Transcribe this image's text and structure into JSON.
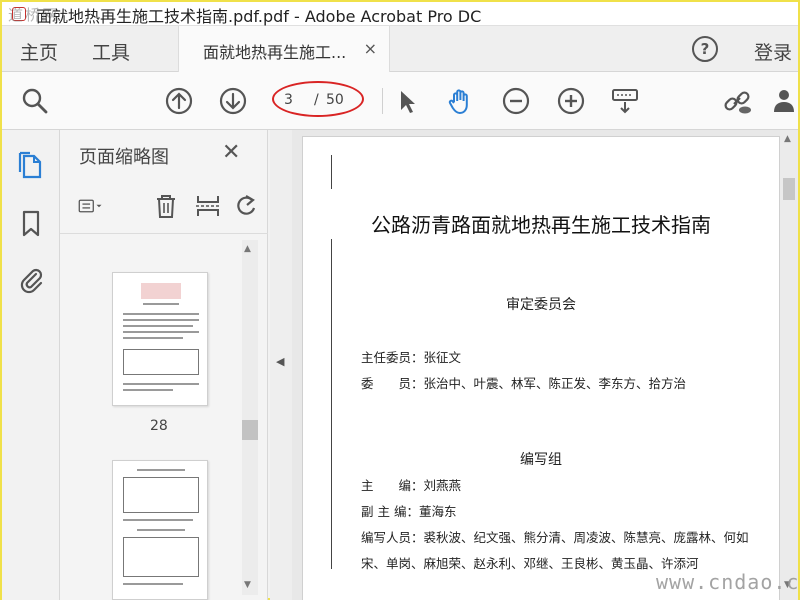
{
  "window": {
    "title": "面就地热再生施工技术指南.pdf.pdf - Adobe Acrobat Pro DC",
    "watermark_top": "道桥网"
  },
  "tabs": {
    "home": "主页",
    "tools": "工具",
    "document": "面就地热再生施工...",
    "close": "×",
    "help": "?",
    "login": "登录"
  },
  "toolbar": {
    "current_page": "3",
    "separator": "/",
    "total_pages": "50",
    "icons": [
      "search-icon",
      "page-up-icon",
      "page-down-icon",
      "select-arrow-icon",
      "hand-icon",
      "zoom-out-icon",
      "zoom-in-icon",
      "keyboard-download-icon",
      "link-icon",
      "share-user-icon"
    ]
  },
  "sidebar": {
    "panel_title": "页面缩略图",
    "close": "✕",
    "thumbnails": [
      {
        "label": "28"
      }
    ]
  },
  "document": {
    "title": "公路沥青路面就地热再生施工技术指南",
    "section1": "审定委员会",
    "line1": "主任委员：张征文",
    "line2": "委　　员：张治中、叶震、林军、陈正发、李东方、拾方治",
    "section2": "编写组",
    "line3": "主　　编：刘燕燕",
    "line4": "副 主 编：董海东",
    "line5": "编写人员：裘秋波、纪文强、熊分清、周凌波、陈慧亮、庞露林、何如",
    "line6": "宋、单岗、麻旭荣、赵永利、邓继、王良彬、黄玉晶、许添河"
  },
  "footer": {
    "watermark": "www.cndao.com"
  },
  "colors": {
    "accent_blue": "#2b7fd4",
    "highlight_red": "#d92424",
    "frame_yellow": "#f0e14a"
  }
}
